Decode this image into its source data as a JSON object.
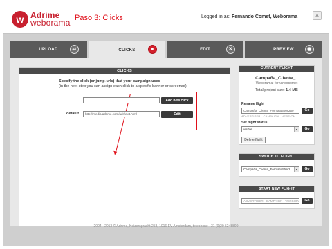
{
  "header": {
    "logo_letter": "w",
    "logo_line1": "Adrime",
    "logo_line2": "weborama",
    "step_label": "Paso 3: Clicks",
    "login_prefix": "Logged in as:",
    "login_user": "Fernando Comet, Weborama",
    "close_glyph": "×"
  },
  "tabs": [
    {
      "label": "UPLOAD",
      "icon": "upload-icon",
      "glyph": "⇄"
    },
    {
      "label": "CLICKS",
      "icon": "target-icon",
      "glyph": "●"
    },
    {
      "label": "EDIT",
      "icon": "tools-icon",
      "glyph": "✕"
    },
    {
      "label": "PREVIEW",
      "icon": "eye-icon",
      "glyph": "◉"
    }
  ],
  "clicks": {
    "panel_title": "CLICKS",
    "intro_line1": "Specify the click (or jump-urls) that your campaign uses",
    "intro_line2": "(in the next step you can assign each click to a specific banner or screenad)",
    "new_click_value": "",
    "add_button": "Add new click",
    "default_label": "default",
    "default_url": "http://media.adrime.com/ads/exit.html",
    "edit_button": "Edit"
  },
  "sidebar": {
    "current": {
      "title": "CURRENT FLIGHT",
      "campaign": "Campaña_Cliente_..",
      "owner": "Weborama: fernandocomet",
      "size_label": "Total project size:",
      "size_value": "1.4 MB",
      "rename_label": "Rename flight",
      "rename_value": "Campaña_Cliente_Formato300x250",
      "rename_hint": "ADVERTISER - CAMPAIGN - VERSION",
      "go": "Go",
      "status_label": "Set flight status",
      "status_value": "visible",
      "delete_button": "Delete flight"
    },
    "switch": {
      "title": "SWITCH TO FLIGHT",
      "value": "Campaña_Cliente_Formato300x2",
      "go": "Go"
    },
    "start": {
      "title": "START NEW FLIGHT",
      "placeholder": "ADVERTISER - CAMPAIGN - VERSION",
      "go": "Go"
    }
  },
  "footer": {
    "text": "2004 - 2013 © Adrime, Keizersgracht 258, 1016 EV Amsterdam, telephone +31 (0)20 5248899"
  }
}
